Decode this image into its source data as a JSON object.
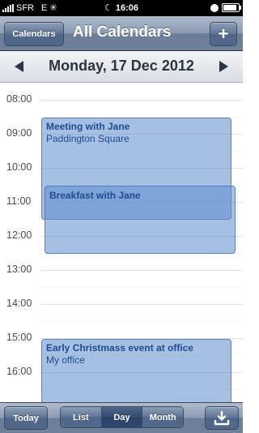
{
  "status_bar": {
    "carrier": "SFR",
    "network": "E",
    "time": "16:06",
    "battery_level": 0.9
  },
  "nav": {
    "calendars_button": "Calendars",
    "title": "All Calendars",
    "add_button": "+"
  },
  "date_bar": {
    "title": "Monday, 17 Dec 2012"
  },
  "hours": [
    "08:00",
    "09:00",
    "10:00",
    "11:00",
    "12:00",
    "13:00",
    "14:00",
    "15:00",
    "16:00"
  ],
  "events": [
    {
      "title": "Meeting with Jane",
      "location": "Paddington Square"
    },
    {
      "title": "Breakfast with Jane",
      "location": ""
    },
    {
      "title": "Early Christmass event at office",
      "location": "My office"
    }
  ],
  "toolbar": {
    "today": "Today",
    "segments": [
      "List",
      "Day",
      "Month"
    ],
    "active_segment": "Day"
  },
  "colors": {
    "event_fill": "#5d8ccd",
    "event_text": "#1d4c8f",
    "bar_blue": "#6e809a"
  },
  "icons": {
    "download": "download-tray-icon",
    "prev": "left-arrow-icon",
    "next": "right-arrow-icon",
    "brightness": "brightness-icon",
    "moon": "moon-icon",
    "lock": "rotation-lock-icon"
  }
}
